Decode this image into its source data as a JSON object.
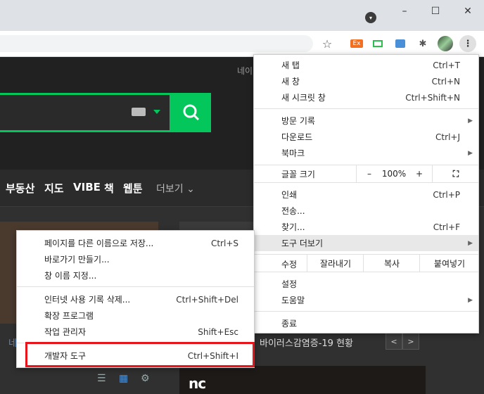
{
  "browser": {
    "window_controls": {
      "minimize": "–",
      "maximize": "☐",
      "close": "✕"
    },
    "tab_search_icon": "▾",
    "toolbar_icons": [
      "star-icon",
      "extension-ex-icon",
      "extension-green-icon",
      "extension-blue-icon",
      "puzzle-icon",
      "profile-avatar",
      "more-menu-icon"
    ],
    "ext_ex_label": "Ex"
  },
  "page": {
    "header_link": "네이",
    "nav": [
      "부동산",
      "지도",
      "VIBE",
      "책",
      "웹툰"
    ],
    "nav_more": "더보기",
    "news_text": "바이러스감염증-19 현황",
    "pager_prev": "<",
    "pager_next": ">",
    "left_fragment": "네",
    "nc_logo": "nc",
    "accent_color": "#03c75a"
  },
  "menu": {
    "new_tab": {
      "label": "새 탭",
      "shortcut": "Ctrl+T"
    },
    "new_window": {
      "label": "새 창",
      "shortcut": "Ctrl+N"
    },
    "incognito": {
      "label": "새 시크릿 창",
      "shortcut": "Ctrl+Shift+N"
    },
    "history": {
      "label": "방문 기록"
    },
    "downloads": {
      "label": "다운로드",
      "shortcut": "Ctrl+J"
    },
    "bookmarks": {
      "label": "북마크"
    },
    "zoom": {
      "label": "글꼴 크기",
      "minus": "–",
      "value": "100%",
      "plus": "+",
      "fullscreen": "⛶"
    },
    "print": {
      "label": "인쇄",
      "shortcut": "Ctrl+P"
    },
    "cast": {
      "label": "전송..."
    },
    "find": {
      "label": "찾기...",
      "shortcut": "Ctrl+F"
    },
    "more_tools": {
      "label": "도구 더보기"
    },
    "edit": {
      "label": "수정",
      "cut": "잘라내기",
      "copy": "복사",
      "paste": "붙여넣기"
    },
    "settings": {
      "label": "설정"
    },
    "help": {
      "label": "도움말"
    },
    "exit": {
      "label": "종료"
    }
  },
  "submenu": {
    "save_as": {
      "label": "페이지를 다른 이름으로 저장...",
      "shortcut": "Ctrl+S"
    },
    "create_shortcut": {
      "label": "바로가기 만들기..."
    },
    "name_window": {
      "label": "창 이름 지정..."
    },
    "clear_data": {
      "label": "인터넷 사용 기록 삭제...",
      "shortcut": "Ctrl+Shift+Del"
    },
    "extensions": {
      "label": "확장 프로그램"
    },
    "task_manager": {
      "label": "작업 관리자",
      "shortcut": "Shift+Esc"
    },
    "dev_tools": {
      "label": "개발자 도구",
      "shortcut": "Ctrl+Shift+I"
    }
  }
}
